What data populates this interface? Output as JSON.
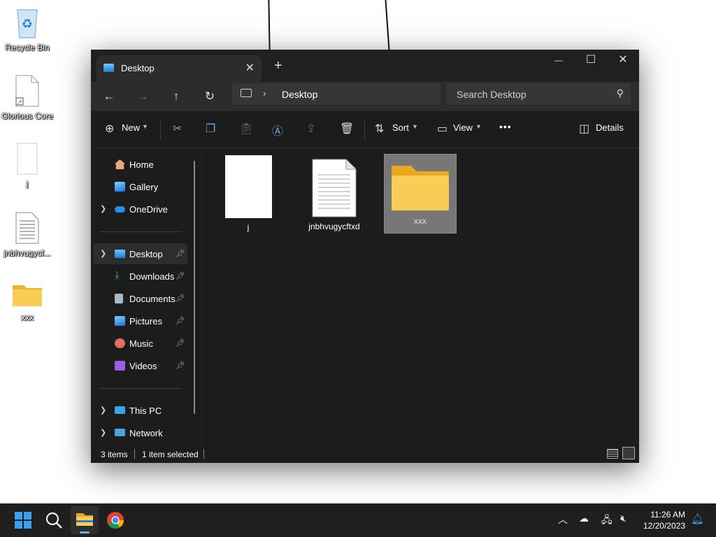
{
  "desktop": {
    "icons": [
      {
        "label": "Recycle Bin"
      },
      {
        "label": "Glorious Core"
      },
      {
        "label": "j"
      },
      {
        "label": "jnbhvugycf..."
      },
      {
        "label": "xxx"
      }
    ]
  },
  "window": {
    "tab_title": "Desktop",
    "new_tab": "+",
    "controls": {
      "minimize": "—",
      "maximize": "☐",
      "close": "✕"
    }
  },
  "address": {
    "location": "Desktop",
    "search_placeholder": "Search Desktop"
  },
  "commands": {
    "new": "New",
    "sort": "Sort",
    "view": "View",
    "more": "•••",
    "details": "Details"
  },
  "sidebar": {
    "quick": [
      {
        "label": "Home"
      },
      {
        "label": "Gallery"
      },
      {
        "label": "OneDrive"
      }
    ],
    "pinned": [
      {
        "label": "Desktop"
      },
      {
        "label": "Downloads"
      },
      {
        "label": "Documents"
      },
      {
        "label": "Pictures"
      },
      {
        "label": "Music"
      },
      {
        "label": "Videos"
      }
    ],
    "devices": [
      {
        "label": "This PC"
      },
      {
        "label": "Network"
      }
    ]
  },
  "files": [
    {
      "name": "j"
    },
    {
      "name": "jnbhvugycftxd"
    },
    {
      "name": "xxx"
    }
  ],
  "status": {
    "items": "3 items",
    "selected": "1 item selected"
  },
  "taskbar": {
    "time": "11:26 AM",
    "date": "12/20/2023"
  },
  "colors": {
    "accent": "#0078d4",
    "folder": "#f5c443",
    "selection": "#777777"
  }
}
